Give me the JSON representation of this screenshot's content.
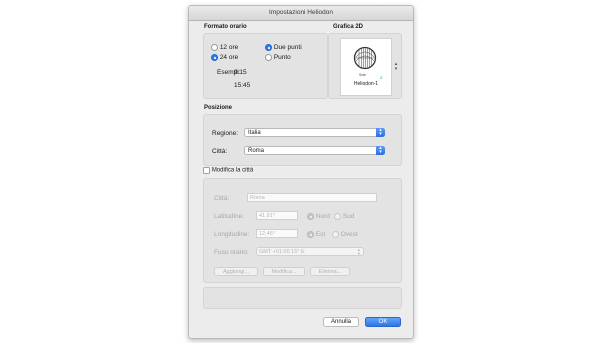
{
  "window": {
    "title": "Impostazioni Heliodon"
  },
  "time_format": {
    "title": "Formato orario",
    "options_hours": [
      {
        "label": "12 ore",
        "selected": false
      },
      {
        "label": "24 ore",
        "selected": true
      }
    ],
    "options_sep": [
      {
        "label": "Due punti",
        "selected": true
      },
      {
        "label": "Punto",
        "selected": false
      }
    ],
    "examples_label": "Esempi:",
    "example_1": "9:15",
    "example_2": "15:45"
  },
  "graphic_2d": {
    "title": "Grafica 2D",
    "preview_caption": "Heliodon-1",
    "preview_small": "Sole",
    "preview_mark": "Z"
  },
  "position": {
    "title": "Posizione",
    "region_label": "Regione:",
    "region_value": "Italia",
    "city_label": "Città:",
    "city_value": "Roma"
  },
  "modify_city": {
    "checkbox_label": "Modifica la città",
    "checked": false,
    "city_label": "Città:",
    "city_placeholder": "Roma",
    "latitude_label": "Latitudine:",
    "latitude_value": "41,91°",
    "north_label": "Nord",
    "south_label": "Sud",
    "longitude_label": "Longitudine:",
    "longitude_value": "12,46°",
    "east_label": "Est",
    "west_label": "Ovest",
    "timezone_label": "Fuso orario:",
    "timezone_value": "GMT +01:00 15° E",
    "add_button": "Aggiungi...",
    "modify_button": "Modifica...",
    "delete_button": "Elimina..."
  },
  "footer": {
    "cancel_button": "Annulla",
    "ok_button": "OK"
  },
  "colors": {
    "accent": "#2d7bf0",
    "panel": "#e3e3e3",
    "window": "#ececec"
  }
}
